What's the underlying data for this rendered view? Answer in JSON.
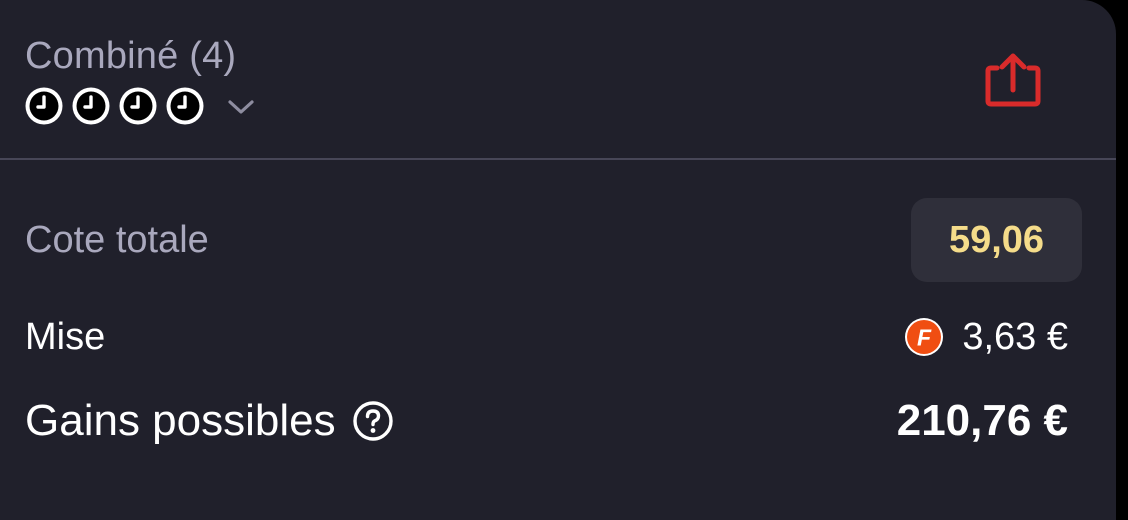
{
  "header": {
    "title": "Combiné (4)",
    "selections": [
      {
        "icon": "clock-icon"
      },
      {
        "icon": "clock-icon"
      },
      {
        "icon": "clock-icon"
      },
      {
        "icon": "clock-icon"
      }
    ],
    "expand_icon": "chevron-down-icon",
    "share_icon": "share-icon"
  },
  "summary": {
    "cote_label": "Cote totale",
    "cote_value": "59,06",
    "mise_label": "Mise",
    "mise_badge": "F",
    "mise_value": "3,63 €",
    "gains_label": "Gains possibles",
    "gains_help_icon": "question-circle-icon",
    "gains_value": "210,76 €"
  },
  "colors": {
    "background": "#20202b",
    "muted_text": "#a9a8bd",
    "cote_value": "#f5dc8a",
    "cote_badge_bg": "#2f2f3a",
    "share_icon": "#d92b2b",
    "freebet_badge": "#f04e12",
    "divider": "#474657"
  }
}
